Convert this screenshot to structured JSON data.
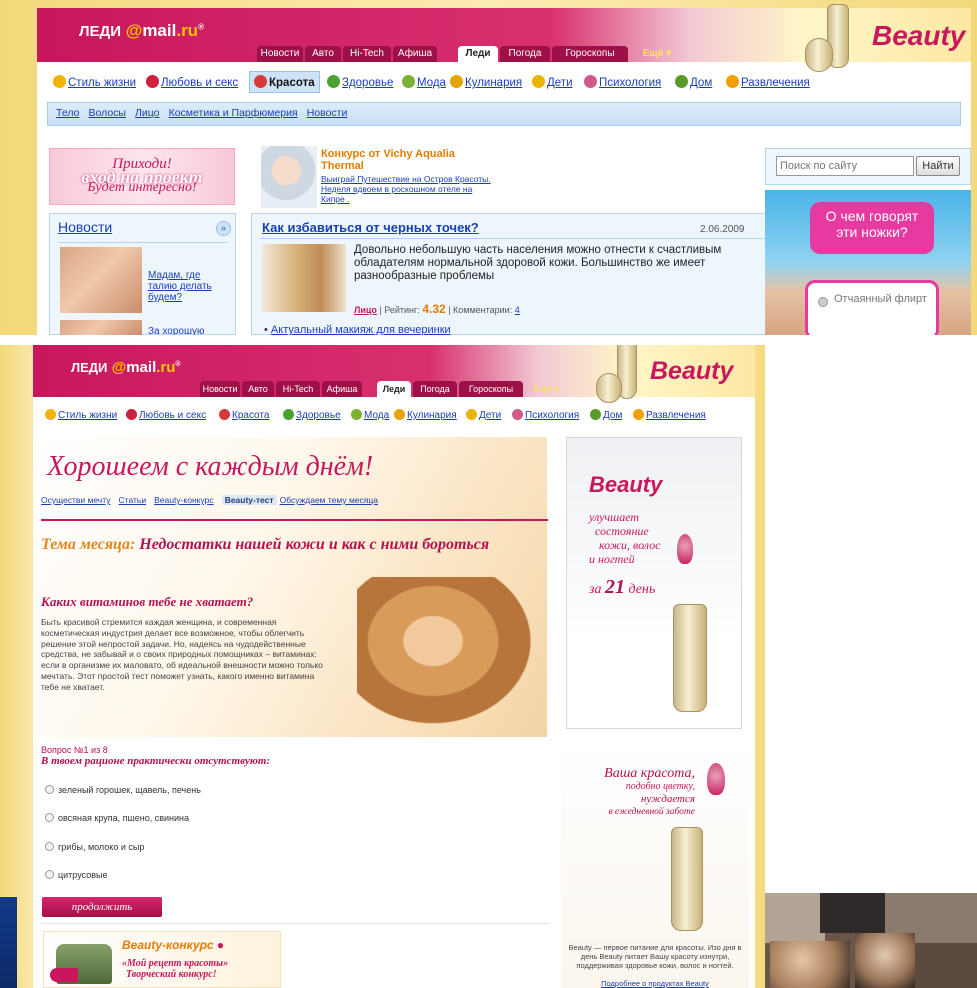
{
  "frame1": {
    "logo": {
      "left": "ЛЕДИ",
      "at": "@",
      "mail": "mail",
      "ru": ".ru",
      "sup": "®"
    },
    "tabs": [
      "Новости",
      "Авто",
      "Hi-Tech",
      "Афиша",
      "Леди",
      "Погода",
      "Гороскопы",
      "Ещё ▾"
    ],
    "beauty": "Beauty",
    "categories": [
      "Стиль жизни",
      "Любовь и секс",
      "Красота",
      "Здоровье",
      "Мода",
      "Кулинария",
      "Дети",
      "Психология",
      "Дом",
      "Развлечения"
    ],
    "subnav": [
      "Тело",
      "Волосы",
      "Лицо",
      "Косметика и Парфюмерия",
      "Новости"
    ],
    "promo": {
      "line1": "Приходи!",
      "line2": "вход на проект",
      "line3": "Будет интересно!"
    },
    "news_title": "Новости",
    "news_items": [
      "Мадам, где талию делать будем?",
      "За хорошую"
    ],
    "contest": {
      "title": "Конкурс от Vichy Aqualia Thermal",
      "text": "Выиграй Путешествие на Остров Красоты. Неделя вдвоем в роскошном отеле на Кипре ."
    },
    "article": {
      "title": "Как избавиться от черных точек?",
      "date": "2.06.2009",
      "text": "Довольно небольшую часть населения можно отнести к счастливым обладателям нормальной здоровой кожи. Большинство же имеет разнообразные проблемы",
      "tag": "Лицо",
      "rating_label": "| Рейтинг:",
      "rating": "4.32",
      "comments_label": "| Комментарии:",
      "comments": "4"
    },
    "bullet": "Актуальный макияж для вечеринки",
    "search": {
      "placeholder": "Поиск по сайту",
      "button": "Найти"
    },
    "bubble": "О чем говорят эти ножки?",
    "poll_option1": "Отчаянный флирт"
  },
  "frame2": {
    "tabs": [
      "Новости",
      "Авто",
      "Hi-Tech",
      "Афиша",
      "Леди",
      "Погода",
      "Гороскопы",
      "Ещё ▾"
    ],
    "beauty": "Beauty",
    "categories": [
      "Стиль жизни",
      "Любовь и секс",
      "Красота",
      "Здоровье",
      "Мода",
      "Кулинария",
      "Дети",
      "Психология",
      "Дом",
      "Развлечения"
    ],
    "hero_title": "Хорошеем с каждым днём!",
    "section_links": [
      "Осуществи мечту",
      "Статьи",
      "Beauty-конкурс"
    ],
    "section_current": "Beauty-тест",
    "section_last": "Обсуждаем тему месяца",
    "month_label": "Тема месяца:",
    "month_title": "Недостатки нашей кожи и как с ними бороться",
    "vitamin_title": "Каких витаминов тебе не хватает?",
    "vitamin_text": "Быть красивой стремится каждая женщина, и современная косметическая индустрия делает все возможное, чтобы облегчить решение этой непростой задачи. Но, надеясь на чудодейственные средства, не забывай и о своих природных помощниках – витаминах: если в организме их маловато, об идеальной внешности можно только мечтать. Этот простой тест поможет узнать, какого именно витамина тебе не хватает.",
    "question_num": "Вопрос №1 из 8",
    "question": "В твоем рационе практически отсутствуют:",
    "answers": [
      "зеленый горошек, щавель, печень",
      "овсяная крупа, пшено, свинина",
      "грибы, молоко и сыр",
      "цитрусовые"
    ],
    "continue": "продолжить",
    "contest_brand": "Beauty-конкурс",
    "contest_line1": "«Мой рецепт красоты»",
    "contest_line2": "Творческий конкурс!",
    "side_ad": {
      "brand": "Beauty",
      "l1": "улучшает",
      "l2": "состояние",
      "l3": "кожи, волос",
      "l4": "и ногтей",
      "l5_pre": "за",
      "l5_num": "21",
      "l5_post": "день"
    },
    "side_ad2": {
      "l1": "Ваша красота,",
      "l2": "подобно цветку,",
      "l3": "нуждается",
      "l4": "в ежедневной заботе"
    },
    "side_caption": "Beauty — первое питание для красоты. Изо дня в день Beauty питает Вашу красоту изнутри, поддерживая здоровье кожи, волос и ногтей.",
    "side_link": "Подробнее о продуктах Beauty"
  }
}
